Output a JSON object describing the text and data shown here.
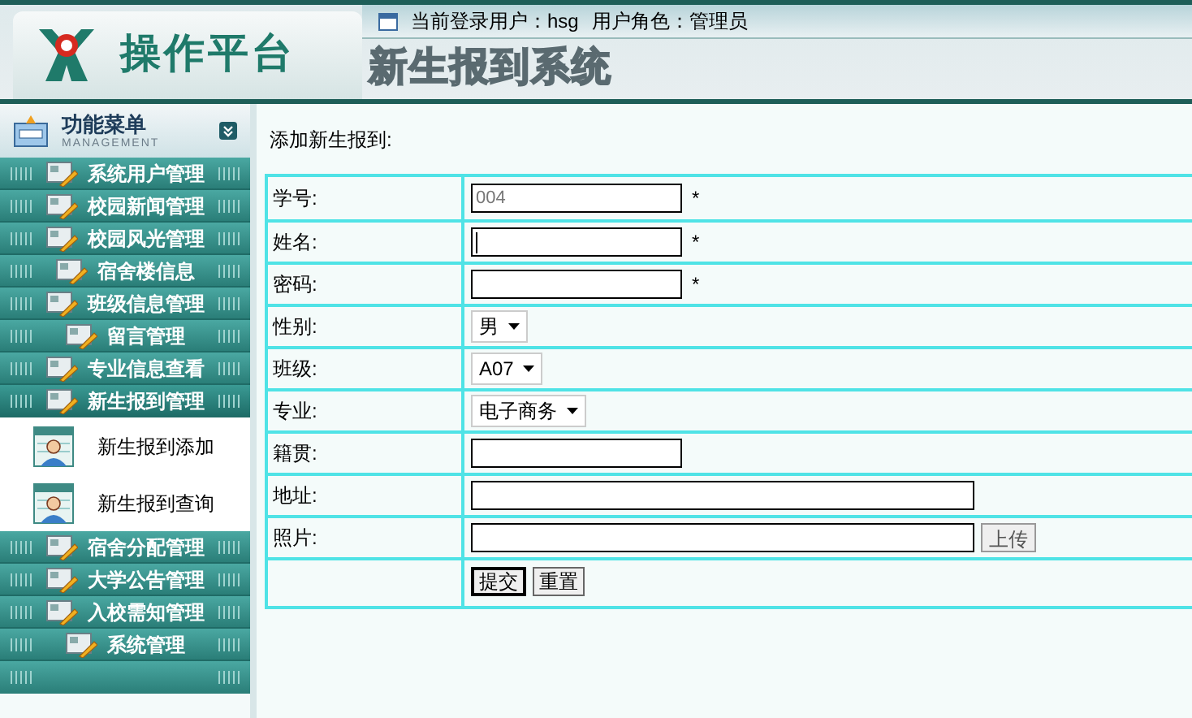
{
  "header": {
    "brand": "操作平台",
    "system_title": "新生报到系统",
    "current_user": "当前登录用户：hsg",
    "user_role": "用户角色：管理员"
  },
  "sidebar": {
    "title": "功能菜单",
    "subtitle": "MANAGEMENT",
    "items": [
      {
        "label": "系统用户管理",
        "expanded": false
      },
      {
        "label": "校园新闻管理",
        "expanded": false
      },
      {
        "label": "校园风光管理",
        "expanded": false
      },
      {
        "label": "宿舍楼信息",
        "expanded": false
      },
      {
        "label": "班级信息管理",
        "expanded": false
      },
      {
        "label": "留言管理",
        "expanded": false
      },
      {
        "label": "专业信息查看",
        "expanded": false
      },
      {
        "label": "新生报到管理",
        "expanded": true,
        "children": [
          {
            "label": "新生报到添加"
          },
          {
            "label": "新生报到查询"
          }
        ]
      },
      {
        "label": "宿舍分配管理",
        "expanded": false
      },
      {
        "label": "大学公告管理",
        "expanded": false
      },
      {
        "label": "入校需知管理",
        "expanded": false
      },
      {
        "label": "系统管理",
        "expanded": false
      }
    ]
  },
  "form": {
    "heading": "添加新生报到:",
    "rows": [
      {
        "label": "学号:",
        "kind": "input",
        "value": "004",
        "mark": "*"
      },
      {
        "label": "姓名:",
        "kind": "input",
        "focused": true,
        "mark": "*"
      },
      {
        "label": "密码:",
        "kind": "input",
        "mark": "*"
      },
      {
        "label": "性别:",
        "kind": "select",
        "value": "男"
      },
      {
        "label": "班级:",
        "kind": "select",
        "value": "A07"
      },
      {
        "label": "专业:",
        "kind": "select",
        "value": "电子商务"
      },
      {
        "label": "籍贯:",
        "kind": "input"
      },
      {
        "label": "地址:",
        "kind": "wide_input"
      },
      {
        "label": "照片:",
        "kind": "upload",
        "button": "上传"
      },
      {
        "kind": "buttons",
        "buttons": [
          "提交",
          "重置"
        ]
      }
    ]
  }
}
